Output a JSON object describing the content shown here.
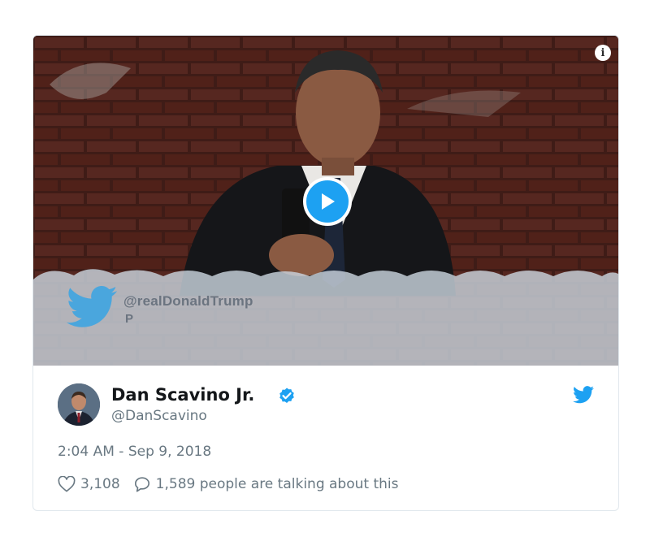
{
  "media": {
    "info_icon": "info-icon",
    "play_icon": "play-icon",
    "overlay_handle": "@realDonaldTrump",
    "overlay_sub": "P",
    "colors": {
      "play": "#1da1f2",
      "brick": "#5a2a22"
    }
  },
  "author": {
    "name": "Dan Scavino Jr.",
    "handle": "@DanScavino",
    "verified_icon": "verified-badge-icon"
  },
  "tweet": {
    "timestamp": "2:04 AM - Sep 9, 2018",
    "likes": "3,108",
    "talking": "1,589 people are talking about this"
  },
  "colors": {
    "accent": "#1da1f2",
    "name_text": "#14171a",
    "meta_text": "#697882",
    "border": "#e1e8ed"
  }
}
